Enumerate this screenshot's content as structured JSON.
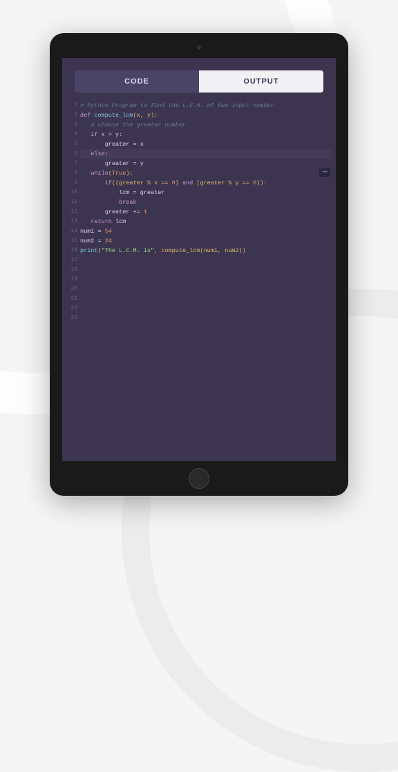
{
  "tabs": {
    "code": "CODE",
    "output": "OUTPUT"
  },
  "lines": [
    "1",
    "2",
    "3",
    "4",
    "5",
    "6",
    "7",
    "8",
    "9",
    "10",
    "11",
    "12",
    "13",
    "14",
    "15",
    "16",
    "17",
    "18",
    "19",
    "20",
    "21",
    "22",
    "23"
  ],
  "code": {
    "l1": "# Python Program to find the L.C.M. of two input number",
    "l2": "",
    "l3_def": "def ",
    "l3_fn": "compute_lcm",
    "l3_p": "(x, y):",
    "l4": "",
    "l5": "   # choose the greater number",
    "l6_if": "   if ",
    "l6_c": "x > y:",
    "l7": "       greater = x",
    "l8_else": "   else",
    "l8_c": ":",
    "l9": "       greater = y",
    "l10": "",
    "l11_w": "   while",
    "l11_p": "(",
    "l11_t": "True",
    "l11_p2": "):",
    "l12_i": "       if",
    "l12_a": "((greater % x == ",
    "l12_z1": "0",
    "l12_b": ") ",
    "l12_and": "and",
    "l12_c": " (greater % y == ",
    "l12_z2": "0",
    "l12_d": ")):",
    "l13": "           lcm = greater",
    "l14_b": "           break",
    "l15_a": "       greater += ",
    "l15_n": "1",
    "l16": "",
    "l17_r": "   return ",
    "l17_v": "lcm",
    "l18": "",
    "l19_a": "num1 = ",
    "l19_n": "54",
    "l20_a": "num2 = ",
    "l20_n": "24",
    "l21": "",
    "l22_p": "print",
    "l22_a": "(",
    "l22_s": "\"The L.C.M. is\"",
    "l22_b": ", compute_lcm(num1, num2))"
  },
  "more": "•••"
}
